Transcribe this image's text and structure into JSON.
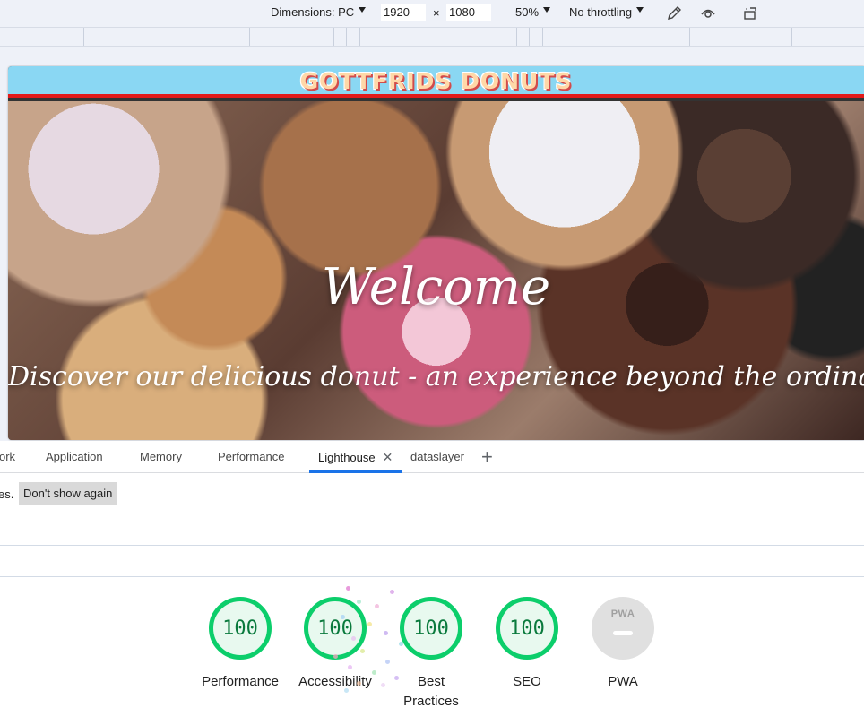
{
  "device_toolbar": {
    "dimensions_label": "Dimensions: PC",
    "width_value": "1920",
    "times": "×",
    "height_value": "1080",
    "zoom": "50%",
    "throttling": "No throttling"
  },
  "site": {
    "logo": "GOTTFRIDS DONUTS",
    "hero_title": "Welcome",
    "hero_subtitle": "Discover our delicious donut - an experience beyond the ordinary!"
  },
  "devtools_tabs": {
    "tabs": [
      "ork",
      "Application",
      "Memory",
      "Performance",
      "Lighthouse",
      "dataslayer"
    ],
    "active": "Lighthouse",
    "add": "+"
  },
  "infobar": {
    "text": "es.",
    "dont_show_again": "Don't show again"
  },
  "scores": [
    {
      "label": "Performance",
      "value": "100"
    },
    {
      "label": "Accessibility",
      "value": "100"
    },
    {
      "label": "Best Practices",
      "value": "100"
    },
    {
      "label": "SEO",
      "value": "100"
    },
    {
      "label": "PWA",
      "value": "PWA"
    }
  ],
  "colors": {
    "pass": "#0cce6b",
    "accent": "#1a73e8",
    "header_bg": "#8ad7f3",
    "header_border": "#e21a1a"
  }
}
